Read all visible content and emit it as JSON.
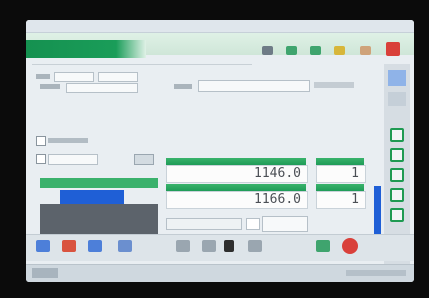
{
  "displays": {
    "value_1": "1146.0",
    "value_2": "1166.0",
    "count_1": "1",
    "count_2": "1"
  },
  "colors": {
    "brand_green": "#1a9d59",
    "blue_bar": "#1f5fd6",
    "gray_panel": "#5c636b"
  }
}
